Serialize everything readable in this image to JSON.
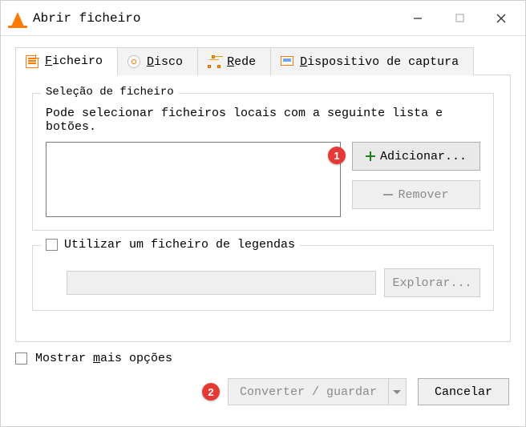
{
  "window": {
    "title": "Abrir ficheiro"
  },
  "tabs": {
    "file_prefix": "F",
    "file_rest": "icheiro",
    "disc_prefix": "D",
    "disc_rest": "isco",
    "net_prefix": "R",
    "net_rest": "ede",
    "dev_prefix": "D",
    "dev_rest": "ispositivo de captura"
  },
  "group": {
    "legend": "Seleção de ficheiro",
    "hint": "Pode selecionar ficheiros locais com a seguinte lista e botões."
  },
  "buttons": {
    "add": "Adicionar...",
    "remove": "Remover",
    "browse": "Explorar...",
    "convert": "Converter / guardar",
    "cancel": "Cancelar"
  },
  "subtitle": {
    "label": "Utilizar um ficheiro de legendas"
  },
  "more": {
    "prefix": "Mostrar ",
    "accel": "m",
    "rest": "ais opções"
  },
  "callouts": {
    "one": "1",
    "two": "2"
  }
}
